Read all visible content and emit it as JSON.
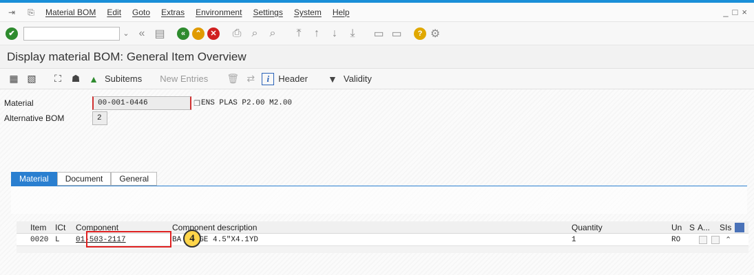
{
  "menu": {
    "items": [
      "Material BOM",
      "Edit",
      "Goto",
      "Extras",
      "Environment",
      "Settings",
      "System",
      "Help"
    ],
    "window_controls": [
      "_",
      "□",
      "×"
    ]
  },
  "toolbar": {
    "command_field": ""
  },
  "title": "Display material BOM: General Item Overview",
  "app_toolbar": {
    "subitems_label": "Subitems",
    "new_entries_label": "New Entries",
    "header_label": "Header",
    "validity_label": "Validity"
  },
  "header": {
    "material_label": "Material",
    "material_value": "00-001-0446",
    "material_desc": "ENS PLAS P2.00 M2.00",
    "alt_bom_label": "Alternative BOM",
    "alt_bom_value": "2"
  },
  "tabs": [
    "Material",
    "Document",
    "General"
  ],
  "table": {
    "columns": [
      "Item",
      "ICt",
      "Component",
      "Component description",
      "Quantity",
      "Un",
      "S",
      "A...",
      "SIs"
    ],
    "rows": [
      {
        "item": "0020",
        "ict": "L",
        "component": "01-503-2117",
        "desc_before": "BA",
        "desc_after": "GE 4.5\"X4.1YD",
        "quantity": "1",
        "unit": "RO"
      }
    ]
  },
  "annotation": {
    "step_number": "4"
  }
}
